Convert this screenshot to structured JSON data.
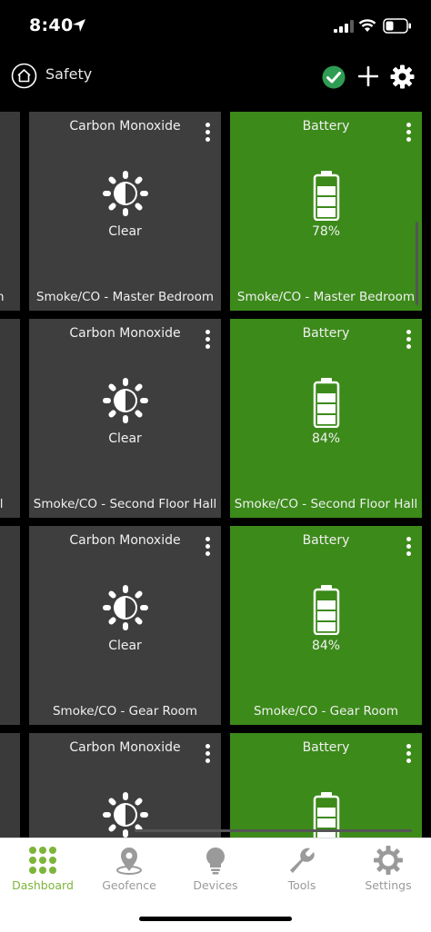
{
  "status_bar": {
    "time": "8:40",
    "icons": [
      "location-arrow-icon",
      "cellular-signal-icon",
      "wifi-icon",
      "battery-icon"
    ]
  },
  "header": {
    "title": "Safety",
    "icons": [
      "home-icon",
      "check-circle-icon",
      "plus-icon",
      "gear-icon"
    ],
    "accent": "#2e9c52"
  },
  "tiles": [
    {
      "co": {
        "title": "Carbon Monoxide",
        "value": "Clear",
        "label": "Smoke/CO - Master Bedroom",
        "icon": "sun-half-icon"
      },
      "battery": {
        "title": "Battery",
        "value": "78%",
        "label": "Smoke/CO - Master Bedroom",
        "icon": "battery-level-icon"
      },
      "left_strip_label": "n"
    },
    {
      "co": {
        "title": "Carbon Monoxide",
        "value": "Clear",
        "label": "Smoke/CO - Second Floor Hall",
        "icon": "sun-half-icon"
      },
      "battery": {
        "title": "Battery",
        "value": "84%",
        "label": "Smoke/CO - Second Floor Hall",
        "icon": "battery-level-icon"
      },
      "left_strip_label": "ll"
    },
    {
      "co": {
        "title": "Carbon Monoxide",
        "value": "Clear",
        "label": "Smoke/CO - Gear Room",
        "icon": "sun-half-icon"
      },
      "battery": {
        "title": "Battery",
        "value": "84%",
        "label": "Smoke/CO - Gear Room",
        "icon": "battery-level-icon"
      },
      "left_strip_label": ""
    },
    {
      "co": {
        "title": "Carbon Monoxide",
        "value": "",
        "label": "",
        "icon": "sun-half-icon"
      },
      "battery": {
        "title": "Battery",
        "value": "",
        "label": "",
        "icon": "battery-level-icon"
      },
      "left_strip_label": ""
    }
  ],
  "colors": {
    "tile_gray": "#3e3e3e",
    "tile_green": "#3c8a1a",
    "tab_active": "#7db53a",
    "tab_inactive": "#9a9a9a"
  },
  "tab_bar": {
    "tabs": [
      {
        "label": "Dashboard",
        "icon": "grid-dots-icon",
        "active": true
      },
      {
        "label": "Geofence",
        "icon": "map-pin-icon",
        "active": false
      },
      {
        "label": "Devices",
        "icon": "lightbulb-icon",
        "active": false
      },
      {
        "label": "Tools",
        "icon": "wrench-icon",
        "active": false
      },
      {
        "label": "Settings",
        "icon": "gear-icon",
        "active": false
      }
    ]
  }
}
